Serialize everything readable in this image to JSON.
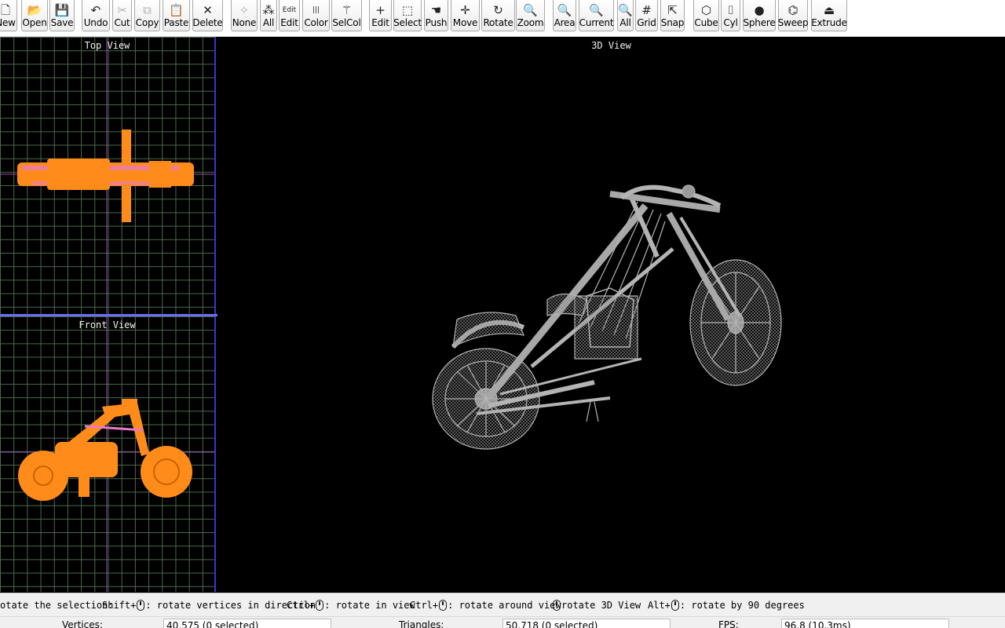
{
  "toolbar": {
    "buttons": [
      {
        "label": "New",
        "icon": "new-file-icon",
        "glyph": "🗋"
      },
      {
        "label": "Open",
        "icon": "open-folder-icon",
        "glyph": "📂"
      },
      {
        "label": "Save",
        "icon": "save-icon",
        "glyph": "💾"
      },
      {
        "label": "Undo",
        "icon": "undo-icon",
        "glyph": "↶"
      },
      {
        "label": "Cut",
        "icon": "cut-icon",
        "glyph": "✂"
      },
      {
        "label": "Copy",
        "icon": "copy-icon",
        "glyph": "⧉"
      },
      {
        "label": "Paste",
        "icon": "paste-icon",
        "glyph": "📋"
      },
      {
        "label": "Delete",
        "icon": "delete-x-icon",
        "glyph": "✕"
      },
      {
        "label": "None",
        "icon": "select-none-icon",
        "glyph": "✧"
      },
      {
        "label": "All",
        "icon": "select-all-icon",
        "glyph": "⁂"
      },
      {
        "label": "Edit",
        "icon": "edit-text-icon",
        "glyph": "Edit"
      },
      {
        "label": "Color",
        "icon": "color-bars-icon",
        "glyph": "|||"
      },
      {
        "label": "SelCol",
        "icon": "magic-wand-icon",
        "glyph": "⚚"
      },
      {
        "label": "Edit",
        "icon": "plus-edit-icon",
        "glyph": "+"
      },
      {
        "label": "Select",
        "icon": "select-rect-icon",
        "glyph": "⬚"
      },
      {
        "label": "Push",
        "icon": "hand-push-icon",
        "glyph": "☚"
      },
      {
        "label": "Move",
        "icon": "move-arrows-icon",
        "glyph": "✛"
      },
      {
        "label": "Rotate",
        "icon": "rotate-icon",
        "glyph": "↻"
      },
      {
        "label": "Zoom",
        "icon": "zoom-icon",
        "glyph": "🔍"
      },
      {
        "label": "Area",
        "icon": "zoom-area-icon",
        "glyph": "🔍"
      },
      {
        "label": "Current",
        "icon": "zoom-current-icon",
        "glyph": "🔍"
      },
      {
        "label": "All",
        "icon": "zoom-all-icon",
        "glyph": "🔍"
      },
      {
        "label": "Grid",
        "icon": "grid-icon",
        "glyph": "#"
      },
      {
        "label": "Snap",
        "icon": "snap-icon",
        "glyph": "⇱"
      },
      {
        "label": "Cube",
        "icon": "cube-icon",
        "glyph": "⬡"
      },
      {
        "label": "Cyl",
        "icon": "cylinder-icon",
        "glyph": "⌷"
      },
      {
        "label": "Sphere",
        "icon": "sphere-icon",
        "glyph": "●"
      },
      {
        "label": "Sweep",
        "icon": "sweep-icon",
        "glyph": "⌬"
      },
      {
        "label": "Extrude",
        "icon": "extrude-icon",
        "glyph": "⏏"
      }
    ]
  },
  "views": {
    "top": "Top View",
    "front": "Front View",
    "three_d": "3D View"
  },
  "hints": [
    {
      "text": "otate the selection:"
    },
    {
      "prefix": "Shift+",
      "text": ": rotate vertices in direction"
    },
    {
      "prefix": "Ctrl+",
      "text": ": rotate in view"
    },
    {
      "prefix": "Ctrl+",
      "text": ": rotate around view"
    },
    {
      "prefix": "",
      "text": "rotate 3D View"
    },
    {
      "prefix": "Alt+",
      "text": ": rotate by 90 degrees"
    }
  ],
  "status": {
    "vertices_label": "Vertices:",
    "vertices_value": "40,575  (0 selected)",
    "triangles_label": "Triangles:",
    "triangles_value": "50,718  (0 selected)",
    "fps_label": "FPS:",
    "fps_value": "96.8 (10.3ms)"
  },
  "colors": {
    "grid": "#4c6a4c",
    "selection": "#ff8c1a",
    "wireframe": "#b4b4b4",
    "view_border": "#3737c8"
  }
}
